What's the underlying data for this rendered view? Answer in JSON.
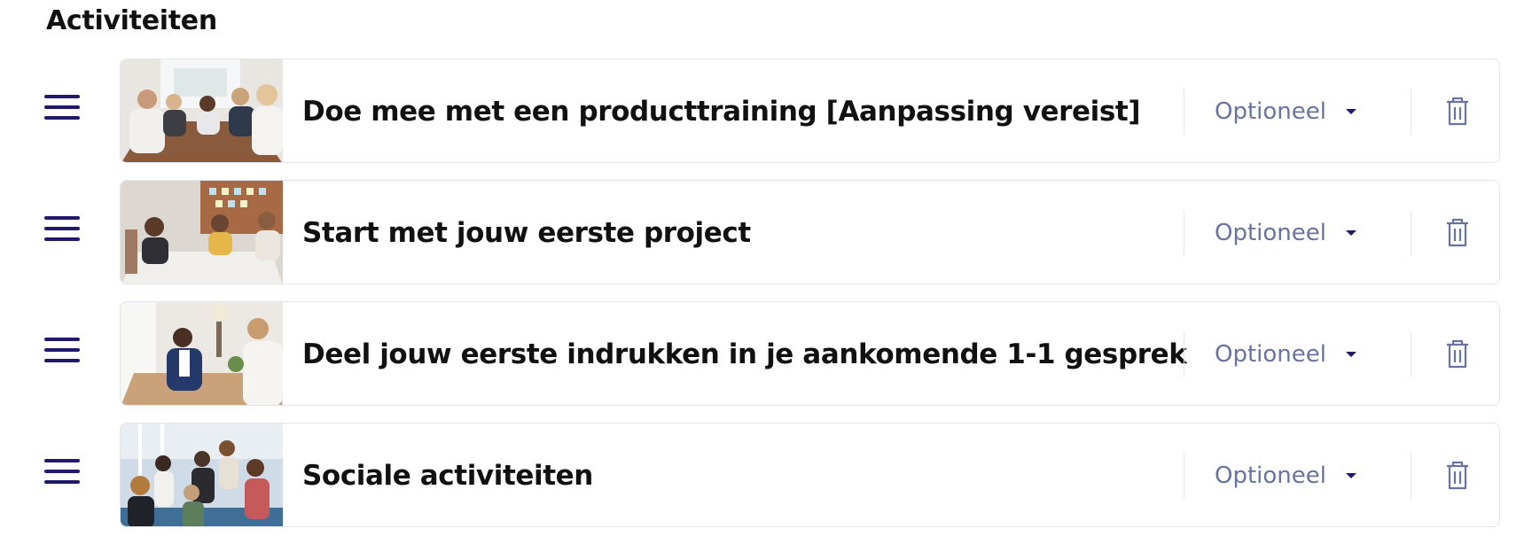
{
  "section": {
    "title": "Activiteiten"
  },
  "colors": {
    "accent": "#1f1a6b",
    "select_text": "#6873a0",
    "border": "#e3e5ec"
  },
  "activities": [
    {
      "title": "Doe mee met een producttraining [Aanpassing vereist]",
      "status": "Optioneel",
      "image": "meeting-presentation-photo"
    },
    {
      "title": "Start met jouw eerste project",
      "status": "Optioneel",
      "image": "team-table-discussion-photo"
    },
    {
      "title": "Deel jouw eerste indrukken in je aankomende 1-1 gesprek",
      "status": "Optioneel",
      "image": "one-on-one-meeting-photo"
    },
    {
      "title": "Sociale activiteiten",
      "status": "Optioneel",
      "image": "social-toast-photo"
    }
  ]
}
